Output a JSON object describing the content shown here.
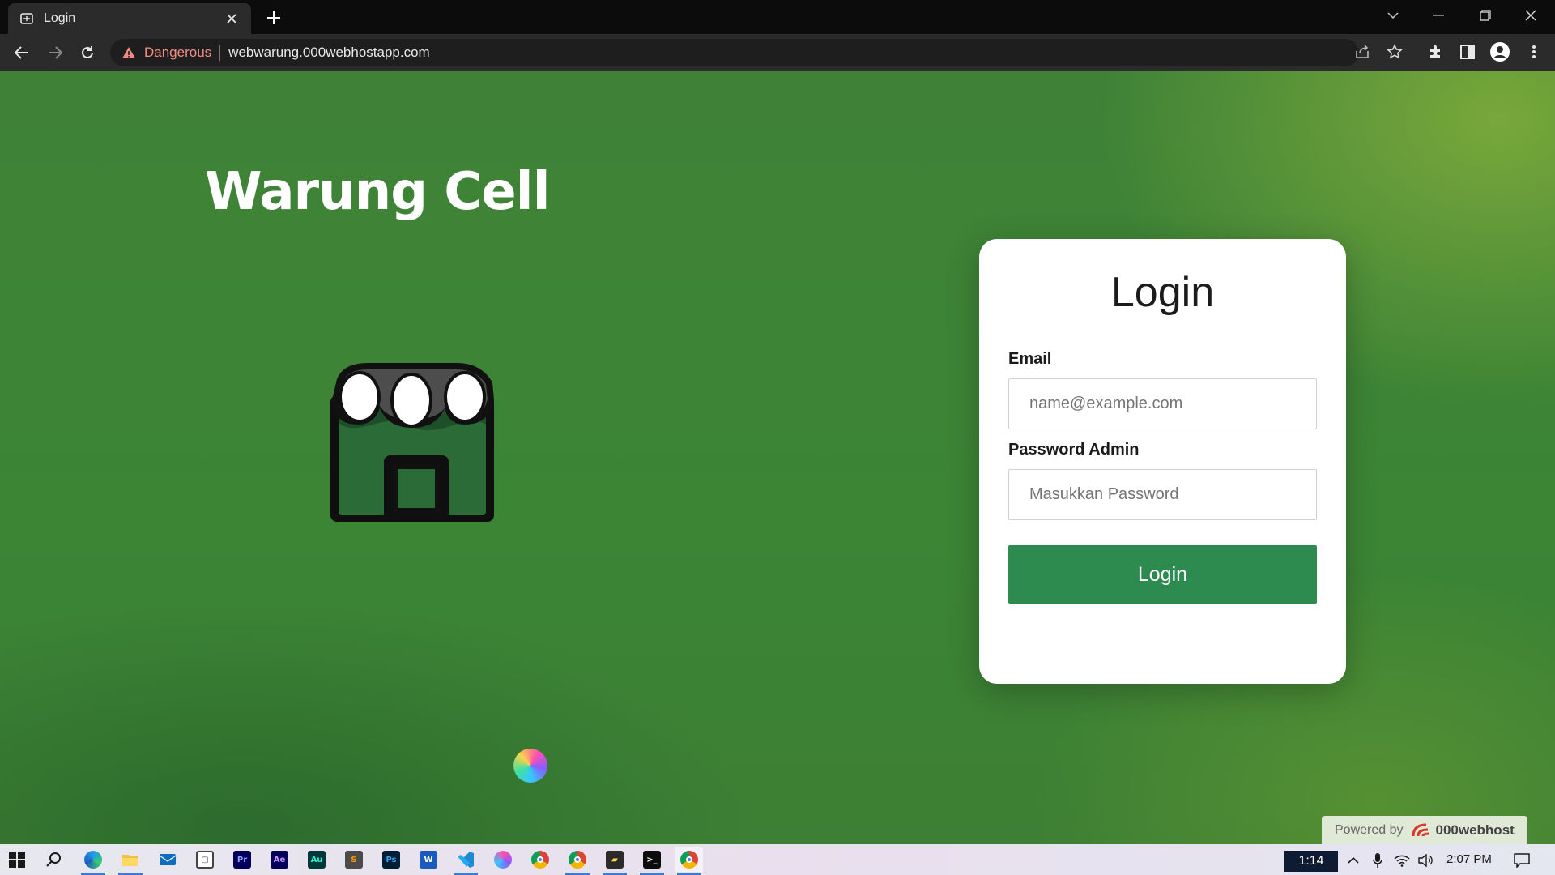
{
  "browser": {
    "tab_title": "Login",
    "security_label": "Dangerous",
    "url": "webwarung.000webhostapp.com"
  },
  "page": {
    "brand_title": "Warung Cell",
    "login_card": {
      "title": "Login",
      "email_label": "Email",
      "email_placeholder": "name@example.com",
      "email_value": "",
      "password_label": "Password Admin",
      "password_placeholder": "Masukkan Password",
      "password_value": "",
      "submit_label": "Login"
    },
    "powered": {
      "prefix": "Powered by",
      "brand": "000webhost"
    }
  },
  "taskbar": {
    "badge_text": "1:14",
    "time": "2:07 PM",
    "apps": [
      "start",
      "search",
      "edge",
      "file-explorer",
      "mail",
      "twitch",
      "premiere-pro",
      "after-effects",
      "audition",
      "sublime-text",
      "photoshop",
      "word",
      "vscode",
      "arc",
      "chrome",
      "chrome-profile",
      "sticky-notes",
      "terminal",
      "chrome-active"
    ]
  },
  "colors": {
    "accent_button": "#2e8b50",
    "page_green": "#3f8237",
    "danger_text": "#f28b82"
  }
}
